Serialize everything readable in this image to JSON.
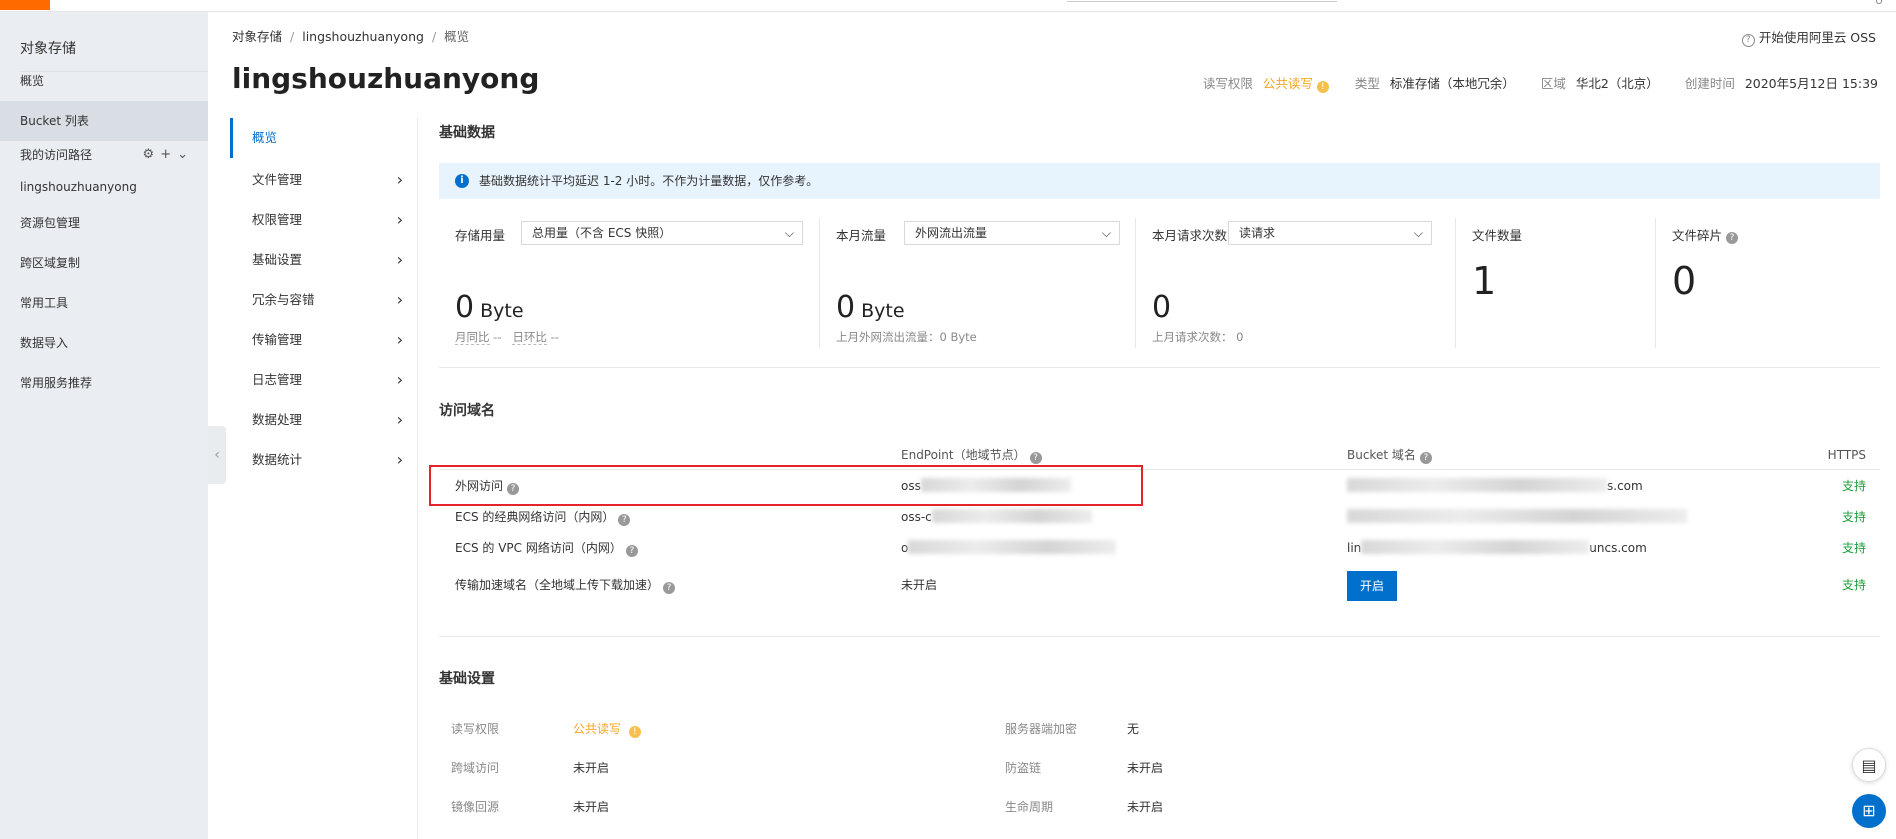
{
  "left_nav": {
    "title": "对象存储",
    "items": [
      {
        "label": "概览",
        "active": false
      },
      {
        "label": "Bucket 列表",
        "active": true
      },
      {
        "label": "我的访问路径",
        "active": false
      },
      {
        "label": "lingshouzhuanyong",
        "active": false
      },
      {
        "label": "资源包管理",
        "active": false
      },
      {
        "label": "跨区域复制",
        "active": false
      },
      {
        "label": "常用工具",
        "active": false
      },
      {
        "label": "数据导入",
        "active": false
      },
      {
        "label": "常用服务推荐",
        "active": false
      }
    ]
  },
  "breadcrumb": [
    "对象存储",
    "lingshouzhuanyong",
    "概览"
  ],
  "help_link": "开始使用阿里云 OSS",
  "bucket": {
    "name": "lingshouzhuanyong",
    "acl_label": "读写权限",
    "acl_value": "公共读写",
    "type_label": "类型",
    "type_value": "标准存储（本地冗余）",
    "region_label": "区域",
    "region_value": "华北2（北京）",
    "created_label": "创建时间",
    "created_value": "2020年5月12日 15:39"
  },
  "sub_nav": [
    {
      "label": "概览",
      "active": true
    },
    {
      "label": "文件管理"
    },
    {
      "label": "权限管理"
    },
    {
      "label": "基础设置"
    },
    {
      "label": "冗余与容错"
    },
    {
      "label": "传输管理"
    },
    {
      "label": "日志管理"
    },
    {
      "label": "数据处理"
    },
    {
      "label": "数据统计"
    }
  ],
  "basic_data": {
    "title": "基础数据",
    "notice": "基础数据统计平均延迟 1-2 小时。不作为计量数据，仅作参考。",
    "storage": {
      "label": "存储用量",
      "select": "总用量（不含 ECS 快照）",
      "value": "0",
      "unit": "Byte",
      "mom": "月同比",
      "mom_val": "--",
      "dod": "日环比",
      "dod_val": "--"
    },
    "traffic": {
      "label": "本月流量",
      "select": "外网流出流量",
      "value": "0",
      "unit": "Byte",
      "sub": "上月外网流出流量：0 Byte"
    },
    "requests": {
      "label": "本月请求次数",
      "select": "读请求",
      "value": "0",
      "sub": "上月请求次数： 0"
    },
    "files": {
      "label": "文件数量",
      "value": "1"
    },
    "fragments": {
      "label": "文件碎片",
      "value": "0"
    }
  },
  "domains": {
    "title": "访问域名",
    "headers": [
      "EndPoint（地域节点）",
      "Bucket 域名",
      "HTTPS"
    ],
    "rows": [
      {
        "name": "外网访问",
        "endpoint": "oss",
        "bucket_domain": "s.com",
        "https": "支持"
      },
      {
        "name": "ECS 的经典网络访问（内网）",
        "endpoint": "oss-c",
        "bucket_domain": "",
        "https": "支持"
      },
      {
        "name": "ECS 的 VPC 网络访问（内网）",
        "endpoint": "o",
        "bucket_domain": "uncs.com",
        "bucket_domain_prefix": "lin",
        "https": "支持"
      },
      {
        "name": "传输加速域名（全地域上传下载加速）",
        "endpoint": "未开启",
        "button": "开启",
        "https": "支持"
      }
    ]
  },
  "basic_settings": {
    "title": "基础设置",
    "left": [
      {
        "k": "读写权限",
        "v": "公共读写"
      },
      {
        "k": "跨域访问",
        "v": "未开启"
      },
      {
        "k": "镜像回源",
        "v": "未开启"
      }
    ],
    "right": [
      {
        "k": "服务器端加密",
        "v": "无"
      },
      {
        "k": "防盗链",
        "v": "未开启"
      },
      {
        "k": "生命周期",
        "v": "未开启"
      }
    ]
  },
  "colors": {
    "accent": "#0070cc",
    "warn": "#f5a623",
    "success": "#1e9e3a",
    "highlight": "#e3242b"
  }
}
